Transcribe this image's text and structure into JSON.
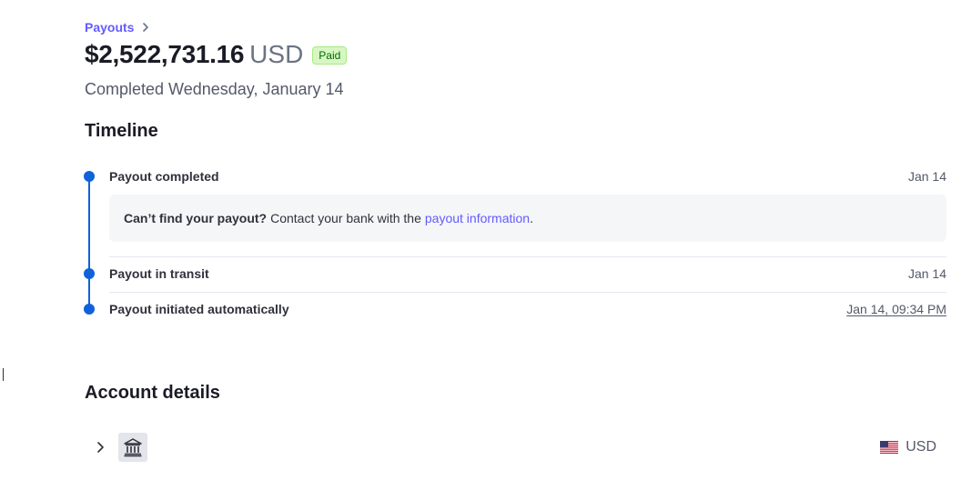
{
  "breadcrumb": {
    "label": "Payouts"
  },
  "header": {
    "amount": "$2,522,731.16",
    "currency": "USD",
    "status_badge": "Paid",
    "subtitle": "Completed Wednesday, January 14"
  },
  "timeline": {
    "title": "Timeline",
    "events": [
      {
        "label": "Payout completed",
        "date": "Jan 14"
      },
      {
        "label": "Payout in transit",
        "date": "Jan 14"
      },
      {
        "label": "Payout initiated automatically",
        "date": "Jan 14, 09:34 PM"
      }
    ],
    "help": {
      "bold": "Can’t find your payout?",
      "text": "Contact your bank with the",
      "link": "payout information",
      "suffix": "."
    }
  },
  "account": {
    "title": "Account details",
    "currency": "USD",
    "icons": [
      "chevron-right-icon",
      "bank-icon",
      "us-flag-icon"
    ]
  },
  "colors": {
    "accent": "#635bff",
    "timeline": "#0f62d9",
    "paid_bg": "#d7f7c2",
    "paid_text": "#006908"
  }
}
